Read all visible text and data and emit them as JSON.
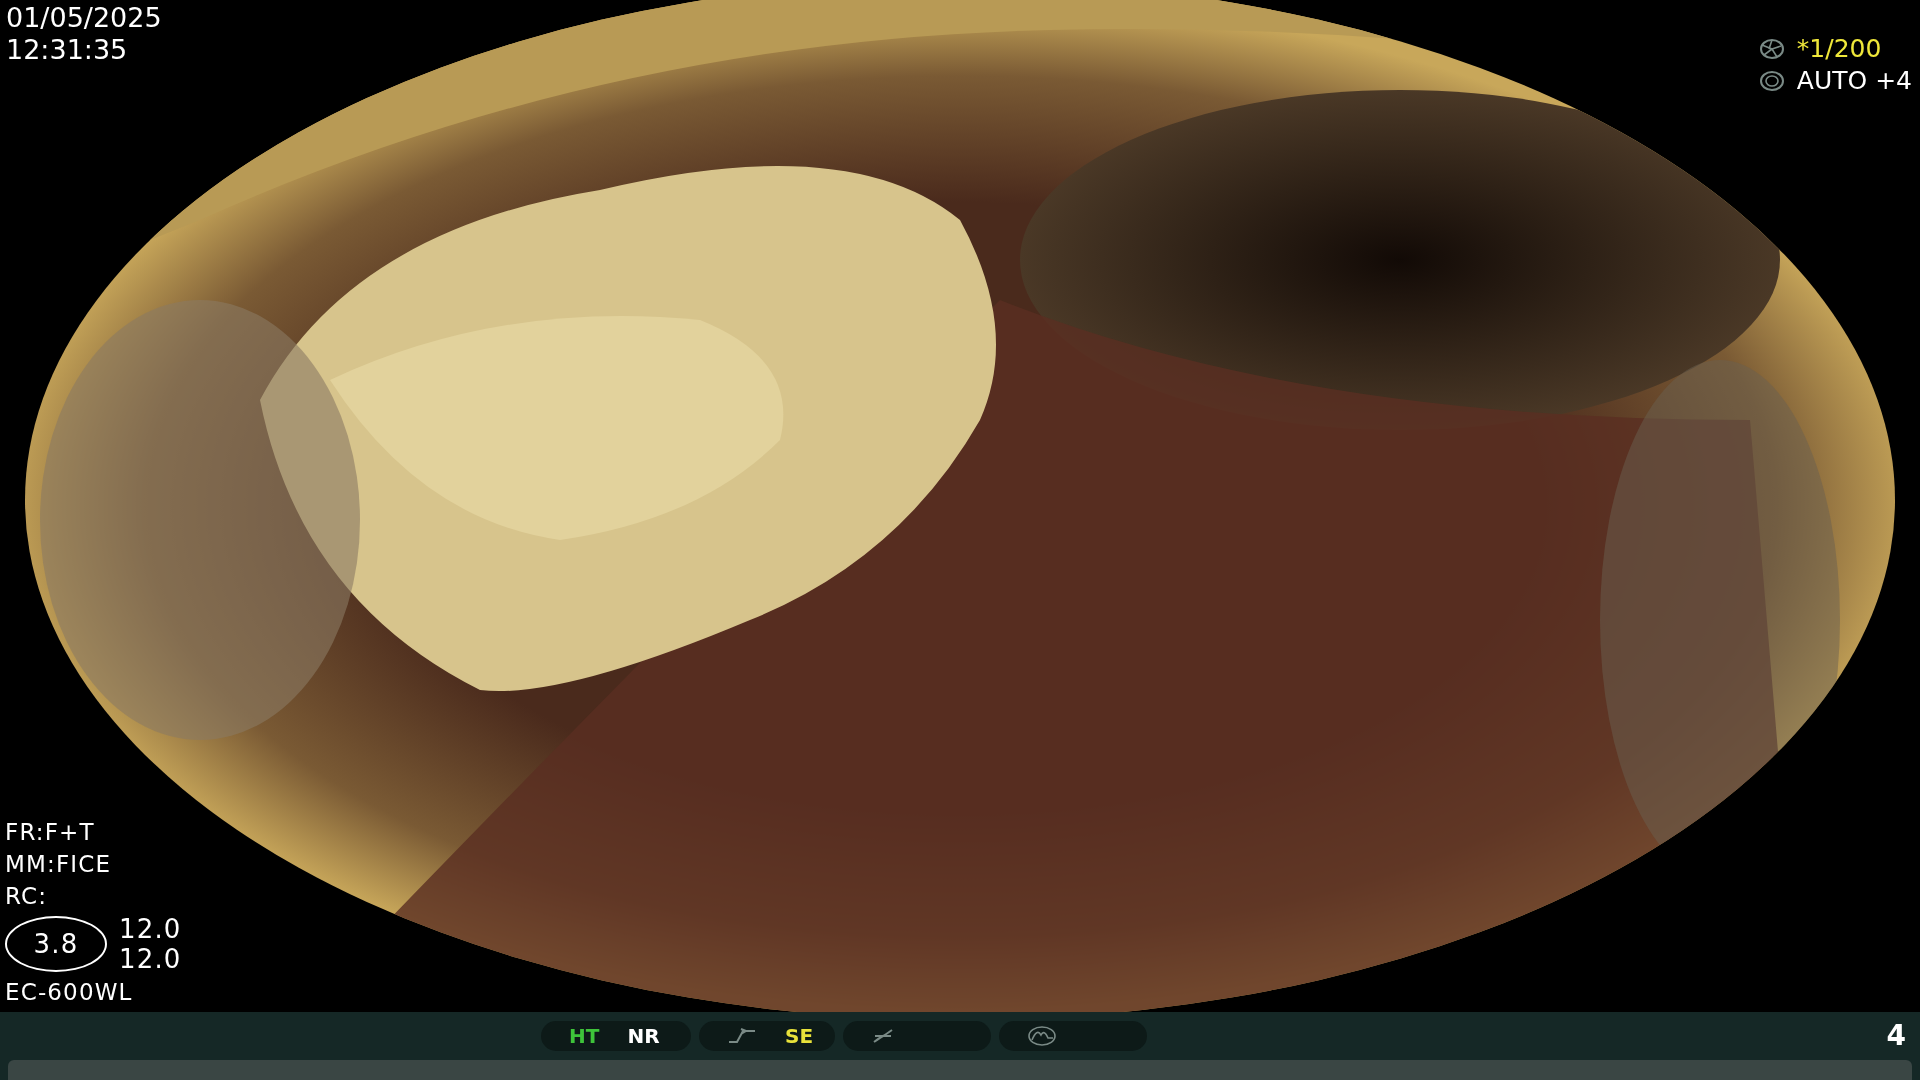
{
  "datetime": {
    "date": "01/05/2025",
    "time": "12:31:35"
  },
  "exposure": {
    "shutter": "*1/200",
    "iris": "AUTO +4"
  },
  "settings": [
    "FR:F+T",
    "MM:FICE",
    "RC:"
  ],
  "enhancement": {
    "level": "3.8",
    "values": [
      "12.0",
      "12.0"
    ]
  },
  "scope_model": "EC-600WL",
  "status_groups": [
    {
      "kind": "text",
      "items": [
        {
          "label": "HT",
          "color": "#3ec43a"
        },
        {
          "label": "NR",
          "color": "#ffffff"
        }
      ]
    },
    {
      "kind": "curve",
      "items": [
        {
          "label": "SE",
          "color": "#e8e23a"
        }
      ]
    },
    {
      "kind": "slash"
    },
    {
      "kind": "wave"
    }
  ],
  "image_count": "4"
}
